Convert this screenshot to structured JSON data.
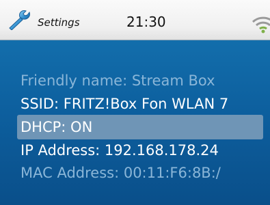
{
  "header": {
    "title": "Settings",
    "time": "21:30",
    "icons": {
      "left": "wrench-icon",
      "right": "wifi-signal-icon"
    }
  },
  "settings": {
    "items": [
      {
        "label": "Friendly name: Stream Box",
        "state": "dim"
      },
      {
        "label": "SSID: FRITZ!Box Fon WLAN 7",
        "state": "normal"
      },
      {
        "label": "DHCP: ON",
        "state": "selected"
      },
      {
        "label": "IP Address: 192.168.178.24",
        "state": "normal"
      },
      {
        "label": "MAC Address: 00:11:F6:8B:/",
        "state": "dim"
      }
    ]
  },
  "colors": {
    "background": "#0d5f9e",
    "selection": "#6f95b6",
    "text": "#ffffff",
    "dim_text": "#8ab6d8",
    "header": "#f0f0f0"
  }
}
